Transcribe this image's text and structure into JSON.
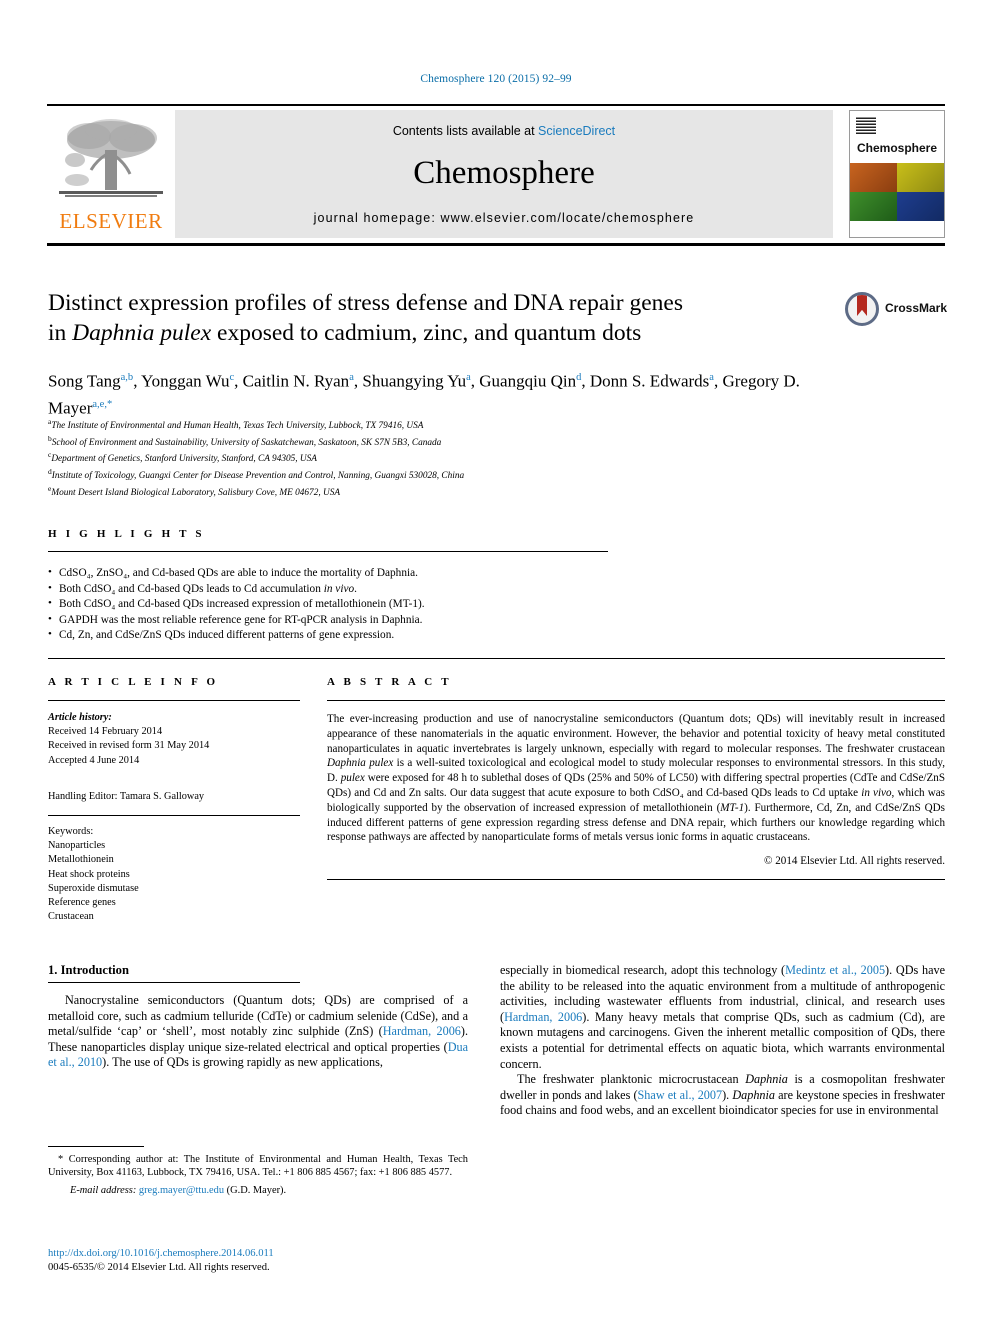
{
  "citation": "Chemosphere 120 (2015) 92–99",
  "masthead": {
    "contents_prefix": "Contents lists available at ",
    "sciencedirect": "ScienceDirect",
    "journal_name": "Chemosphere",
    "homepage": "journal homepage: www.elsevier.com/locate/chemosphere",
    "publisher_logo_text": "ELSEVIER",
    "cover_title": "Chemosphere",
    "accent_blue": "#1a7bbd",
    "elsevier_orange": "#f07c10"
  },
  "article": {
    "title_line1": "Distinct expression profiles of stress defense and DNA repair genes",
    "title_line2_pre": "in ",
    "title_line2_em": "Daphnia pulex",
    "title_line2_post": " exposed to cadmium, zinc, and quantum dots",
    "crossmark_label": "CrossMark",
    "authors": [
      {
        "name": "Song Tang",
        "sup": "a,b",
        "sep": ", "
      },
      {
        "name": "Yonggan Wu",
        "sup": "c",
        "sep": ", "
      },
      {
        "name": "Caitlin N. Ryan",
        "sup": "a",
        "sep": ", "
      },
      {
        "name": "Shuangying Yu",
        "sup": "a",
        "sep": ", "
      },
      {
        "name": "Guangqiu Qin",
        "sup": "d",
        "sep": ", "
      },
      {
        "name": "Donn S. Edwards",
        "sup": "a",
        "sep": ", "
      },
      {
        "name": "Gregory D. Mayer",
        "sup": "a,e,*",
        "sep": ""
      }
    ],
    "affiliations": [
      {
        "mark": "a",
        "text": "The Institute of Environmental and Human Health, Texas Tech University, Lubbock, TX 79416, USA"
      },
      {
        "mark": "b",
        "text": "School of Environment and Sustainability, University of Saskatchewan, Saskatoon, SK S7N 5B3, Canada"
      },
      {
        "mark": "c",
        "text": "Department of Genetics, Stanford University, Stanford, CA 94305, USA"
      },
      {
        "mark": "d",
        "text": "Institute of Toxicology, Guangxi Center for Disease Prevention and Control, Nanning, Guangxi 530028, China"
      },
      {
        "mark": "e",
        "text": "Mount Desert Island Biological Laboratory, Salisbury Cove, ME 04672, USA"
      }
    ]
  },
  "highlights": {
    "heading": "H I G H L I G H T S",
    "items": [
      "CdSO₄, ZnSO₄, and Cd-based QDs are able to induce the mortality of Daphnia.",
      "Both CdSO₄ and Cd-based QDs leads to Cd accumulation in vivo.",
      "Both CdSO₄ and Cd-based QDs increased expression of metallothionein (MT-1).",
      "GAPDH was the most reliable reference gene for RT-qPCR analysis in Daphnia.",
      "Cd, Zn, and CdSe/ZnS QDs induced different patterns of gene expression."
    ]
  },
  "article_info": {
    "heading": "A R T I C L E    I N F O",
    "history_label": "Article history:",
    "history": [
      "Received 14 February 2014",
      "Received in revised form 31 May 2014",
      "Accepted 4 June 2014"
    ],
    "handling_editor": "Handling Editor: Tamara S. Galloway",
    "keywords_label": "Keywords:",
    "keywords": [
      "Nanoparticles",
      "Metallothionein",
      "Heat shock proteins",
      "Superoxide dismutase",
      "Reference genes",
      "Crustacean"
    ]
  },
  "abstract": {
    "heading": "A B S T R A C T",
    "text_part1": "The ever-increasing production and use of nanocrystaline semiconductors (Quantum dots; QDs) will inevitably result in increased appearance of these nanomaterials in the aquatic environment. However, the behavior and potential toxicity of heavy metal constituted nanoparticulates in aquatic invertebrates is largely unknown, especially with regard to molecular responses. The freshwater crustacean ",
    "em1": "Daphnia pulex",
    "text_part2": " is a well-suited toxicological and ecological model to study molecular responses to environmental stressors. In this study, D. ",
    "em2": "pulex",
    "text_part3": " were exposed for 48 h to sublethal doses of QDs (25% and 50% of LC50) with differing spectral properties (CdTe and CdSe/ZnS QDs) and Cd and Zn salts. Our data suggest that acute exposure to both CdSO₄ and Cd-based QDs leads to Cd uptake ",
    "em3": "in vivo",
    "text_part4": ", which was biologically supported by the observation of increased expression of metallothionein (",
    "em4": "MT-1",
    "text_part5": "). Furthermore, Cd, Zn, and CdSe/ZnS QDs induced different patterns of gene expression regarding stress defense and DNA repair, which furthers our knowledge regarding which response pathways are affected by nanoparticulate forms of metals versus ionic forms in aquatic crustaceans.",
    "copyright": "© 2014 Elsevier Ltd. All rights reserved."
  },
  "body": {
    "section_heading": "1. Introduction",
    "left_para_part1": "Nanocrystaline semiconductors (Quantum dots; QDs) are comprised of a metalloid core, such as cadmium telluride (CdTe) or cadmium selenide (CdSe), and a metal/sulfide ‘cap’ or ‘shell’, most notably zinc sulphide (ZnS) (",
    "left_ref1": "Hardman, 2006",
    "left_para_part2": "). These nanoparticles display unique size-related electrical and optical properties (",
    "left_ref2": "Dua et al., 2010",
    "left_para_part3": "). The use of QDs is growing rapidly as new applications,",
    "right_para1_part1": "especially in biomedical research, adopt this technology (",
    "right_ref1": "Medintz et al., 2005",
    "right_para1_part2": "). QDs have the ability to be released into the aquatic environment from a multitude of anthropogenic activities, including wastewater effluents from industrial, clinical, and research uses (",
    "right_ref2": "Hardman, 2006",
    "right_para1_part3": "). Many heavy metals that comprise QDs, such as cadmium (Cd), are known mutagens and carcinogens. Given the inherent metallic composition of QDs, there exists a potential for detrimental effects on aquatic biota, which warrants environmental concern.",
    "right_para2_part1": "The freshwater planktonic microcrustacean ",
    "right_em1": "Daphnia",
    "right_para2_part2": " is a cosmopolitan freshwater dweller in ponds and lakes (",
    "right_ref3": "Shaw et al., 2007",
    "right_para2_part3": "). ",
    "right_em2": "Daphnia",
    "right_para2_part4": " are keystone species in freshwater food chains and food webs, and an excellent bioindicator species for use in environmental"
  },
  "footnote": {
    "corresponding": "* Corresponding author at: The Institute of Environmental and Human Health, Texas Tech University, Box 41163, Lubbock, TX 79416, USA. Tel.: +1 806 885 4567; fax: +1 806 885 4577.",
    "email_label": "E-mail address:",
    "email": "greg.mayer@ttu.edu",
    "email_suffix": " (G.D. Mayer)."
  },
  "doi_block": {
    "doi_url": "http://dx.doi.org/10.1016/j.chemosphere.2014.06.011",
    "issn_line": "0045-6535/© 2014 Elsevier Ltd. All rights reserved."
  }
}
